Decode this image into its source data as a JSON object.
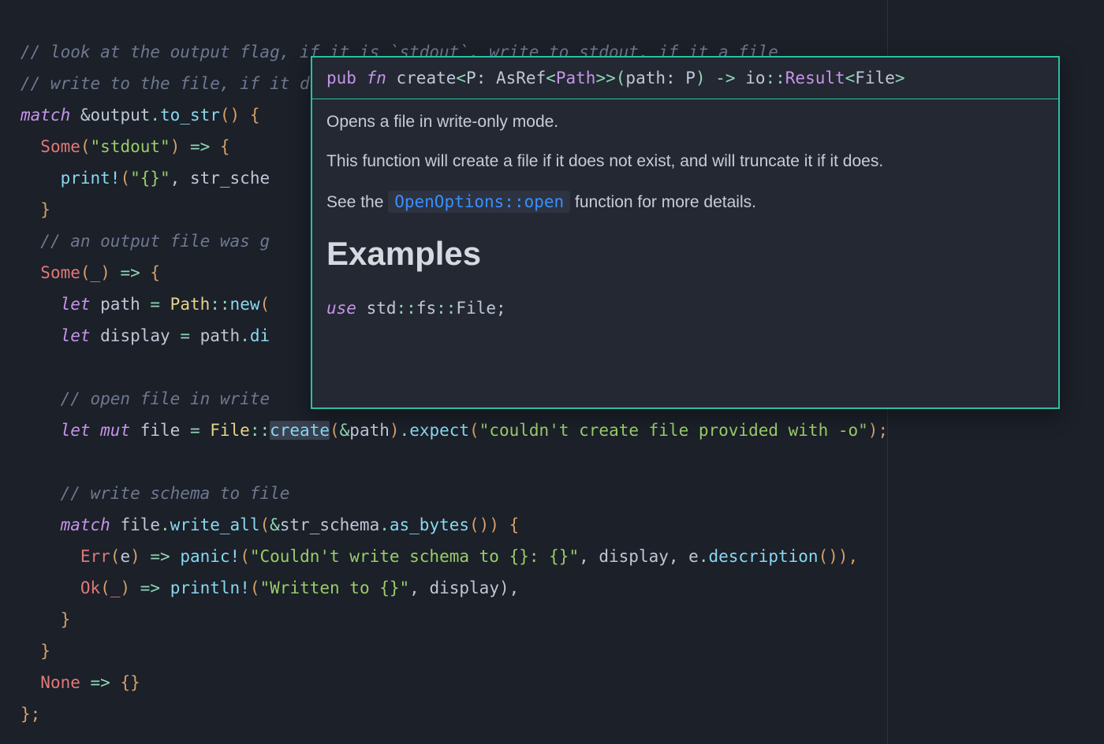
{
  "code": {
    "line1": "// look at the output flag, if it is `stdout`, write to stdout, if it a file",
    "line2": "// write to the file, if it doesn't exist, do nothing??",
    "l3_match": "match",
    "l3_amp": " &",
    "l3_output": "output",
    "l3_dot": ".",
    "l3_tostr": "to_str",
    "l3_paren": "() {",
    "l4_some": "Some",
    "l4_arg": "(\"stdout\")",
    "l4_arrow": " => {",
    "l5_print": "print!",
    "l5_open": "(",
    "l5_fmt": "\"{}\"",
    "l5_comma": ", ",
    "l5_strsch": "str_sche",
    "l6_close": "}",
    "l7_comment": "// an output file was g",
    "l8_some": "Some",
    "l8_open": "(",
    "l8_under": "_",
    "l8_close": ")",
    "l8_arrow": " => {",
    "l9_let": "let",
    "l9_path": " path ",
    "l9_eq": "=",
    "l9_pathty": " Path",
    "l9_dcol": "::",
    "l9_new": "new",
    "l9_open": "(",
    "l10_let": "let",
    "l10_disp": " display ",
    "l10_eq": "=",
    "l10_pathv": " path",
    "l10_dot": ".",
    "l10_di": "di",
    "l12_comment": "// open file in write",
    "l13_let": "let",
    "l13_mut": " mut",
    "l13_file": " file ",
    "l13_eq": "=",
    "l13_filety": " File",
    "l13_dcol": "::",
    "l13_create": "create",
    "l13_open": "(",
    "l13_amp": "&",
    "l13_path": "path",
    "l13_close": ")",
    "l13_dot": ".",
    "l13_expect": "expect",
    "l13_open2": "(",
    "l13_str": "\"couldn't create file provided with -o\"",
    "l13_close2": ");",
    "l15_comment": "// write schema to file",
    "l16_match": "match",
    "l16_filev": " file",
    "l16_dot": ".",
    "l16_wa": "write_all",
    "l16_open": "(",
    "l16_amp": "&",
    "l16_strsch": "str_schema",
    "l16_dot2": ".",
    "l16_ab": "as_bytes",
    "l16_par": "()) {",
    "l17_err": "Err",
    "l17_open": "(",
    "l17_e": "e",
    "l17_close": ")",
    "l17_arrow": " => ",
    "l17_panic": "panic!",
    "l17_open2": "(",
    "l17_str": "\"Couldn't write schema to {}: {}\"",
    "l17_comma": ", display, ",
    "l17_e2": "e",
    "l17_dot": ".",
    "l17_desc": "description",
    "l17_par": "()),",
    "l18_ok": "Ok",
    "l18_open": "(",
    "l18_under": "_",
    "l18_close": ")",
    "l18_arrow": " => ",
    "l18_println": "println!",
    "l18_open2": "(",
    "l18_str": "\"Written to {}\"",
    "l18_rest": ", display),",
    "l19_close": "}",
    "l20_close": "}",
    "l21_none": "None",
    "l21_arrow": " => {}",
    "l22_close": "};"
  },
  "hover": {
    "sig_pub": "pub ",
    "sig_fn": "fn",
    "sig_name": " create",
    "sig_lt": "<",
    "sig_p": "P",
    "sig_colon": ": ",
    "sig_asref": "AsRef",
    "sig_lt2": "<",
    "sig_path": "Path",
    "sig_gt2": ">",
    "sig_gt": ">",
    "sig_open": "(",
    "sig_arg": "path",
    "sig_colon2": ": ",
    "sig_p2": "P",
    "sig_close": ")",
    "sig_arrow": " -> ",
    "sig_io": "io",
    "sig_dcol": "::",
    "sig_result": "Result",
    "sig_lt3": "<",
    "sig_file": "File",
    "sig_gt3": ">",
    "p1": "Opens a file in write-only mode.",
    "p2": "This function will create a file if it does not exist, and will truncate it if it does.",
    "p3a": "See the ",
    "p3_code": "OpenOptions::open",
    "p3b": " function for more details.",
    "h2": "Examples",
    "cb_use": "use",
    "cb_sp": " ",
    "cb_std": "std",
    "cb_dcol1": "::",
    "cb_fs": "fs",
    "cb_dcol2": "::",
    "cb_file": "File;"
  }
}
